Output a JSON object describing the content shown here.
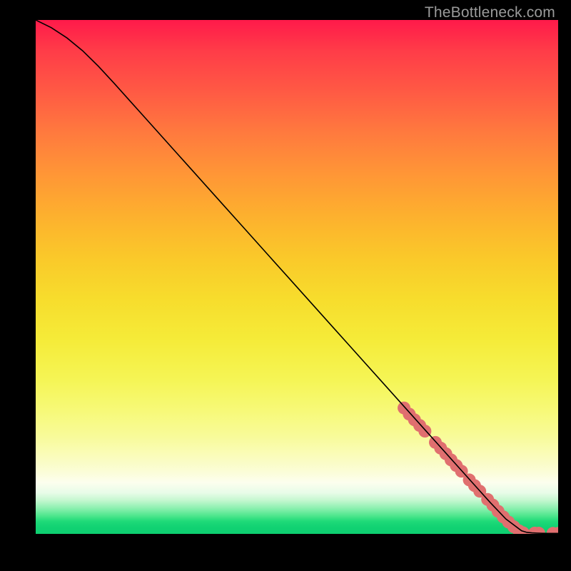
{
  "watermark": "TheBottleneck.com",
  "chart_data": {
    "type": "line",
    "title": "",
    "xlabel": "",
    "ylabel": "",
    "xlim": [
      0,
      100
    ],
    "ylim": [
      0,
      100
    ],
    "grid": false,
    "series": [
      {
        "name": "curve",
        "color": "#000000",
        "x": [
          0,
          3,
          6,
          9,
          12,
          15,
          18,
          21,
          24,
          27,
          30,
          33,
          36,
          39,
          42,
          45,
          48,
          51,
          54,
          57,
          60,
          63,
          66,
          69,
          72,
          75,
          78,
          81,
          84,
          87,
          90,
          93,
          94,
          95,
          96,
          97,
          98,
          99,
          100
        ],
        "y": [
          100,
          98.5,
          96.5,
          94.0,
          91.0,
          87.7,
          84.3,
          80.9,
          77.5,
          74.1,
          70.7,
          67.3,
          63.9,
          60.5,
          57.1,
          53.7,
          50.3,
          46.9,
          43.5,
          40.1,
          36.7,
          33.3,
          29.9,
          26.5,
          23.1,
          19.7,
          16.3,
          12.9,
          9.5,
          6.1,
          2.9,
          0.6,
          0.3,
          0.2,
          0.15,
          0.12,
          0.1,
          0.1,
          0.1
        ]
      }
    ],
    "marker_series": [
      {
        "name": "markers",
        "color": "#e57373",
        "radius": 9,
        "points": [
          {
            "x": 70.5,
            "y": 24.5
          },
          {
            "x": 71.5,
            "y": 23.3
          },
          {
            "x": 72.5,
            "y": 22.2
          },
          {
            "x": 73.5,
            "y": 21.1
          },
          {
            "x": 74.5,
            "y": 20.0
          },
          {
            "x": 76.5,
            "y": 17.8
          },
          {
            "x": 77.5,
            "y": 16.7
          },
          {
            "x": 78.5,
            "y": 15.6
          },
          {
            "x": 79.5,
            "y": 14.4
          },
          {
            "x": 80.5,
            "y": 13.3
          },
          {
            "x": 81.5,
            "y": 12.2
          },
          {
            "x": 83.0,
            "y": 10.5
          },
          {
            "x": 84.0,
            "y": 9.4
          },
          {
            "x": 85.0,
            "y": 8.3
          },
          {
            "x": 86.5,
            "y": 6.7
          },
          {
            "x": 87.5,
            "y": 5.6
          },
          {
            "x": 88.5,
            "y": 4.4
          },
          {
            "x": 89.5,
            "y": 3.3
          },
          {
            "x": 90.5,
            "y": 2.3
          },
          {
            "x": 91.5,
            "y": 1.4
          },
          {
            "x": 92.5,
            "y": 0.6
          },
          {
            "x": 93.3,
            "y": 0.2
          },
          {
            "x": 95.5,
            "y": 0.15
          },
          {
            "x": 96.3,
            "y": 0.13
          },
          {
            "x": 99.0,
            "y": 0.1
          },
          {
            "x": 100.0,
            "y": 0.1
          }
        ]
      }
    ]
  },
  "colors": {
    "markerFill": "#e06f6f",
    "lineStroke": "#000000"
  }
}
